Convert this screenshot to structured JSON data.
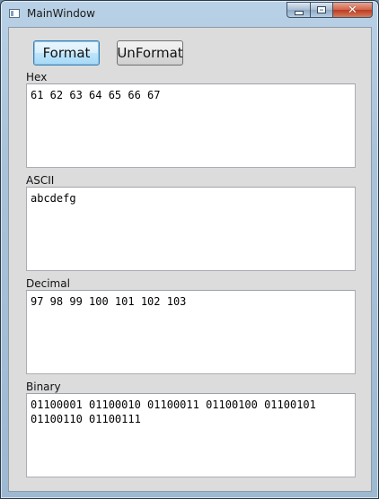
{
  "window": {
    "title": "MainWindow",
    "minimize_glyph": "minimize-icon",
    "maximize_glyph": "maximize-icon",
    "close_glyph": "✕"
  },
  "toolbar": {
    "format_label": "Format",
    "unformat_label": "UnFormat"
  },
  "sections": {
    "hex": {
      "label": "Hex",
      "value": "61 62 63 64 65 66 67"
    },
    "ascii": {
      "label": "ASCII",
      "value": "abcdefg"
    },
    "decimal": {
      "label": "Decimal",
      "value": "97 98 99 100 101 102 103"
    },
    "binary": {
      "label": "Binary",
      "value": "01100001 01100010 01100011 01100100 01100101\n01100110 01100111"
    }
  },
  "colors": {
    "client_background": "#dcdcdc",
    "focused_button_border": "#3c7fb1",
    "close_button": "#bc3b21"
  }
}
